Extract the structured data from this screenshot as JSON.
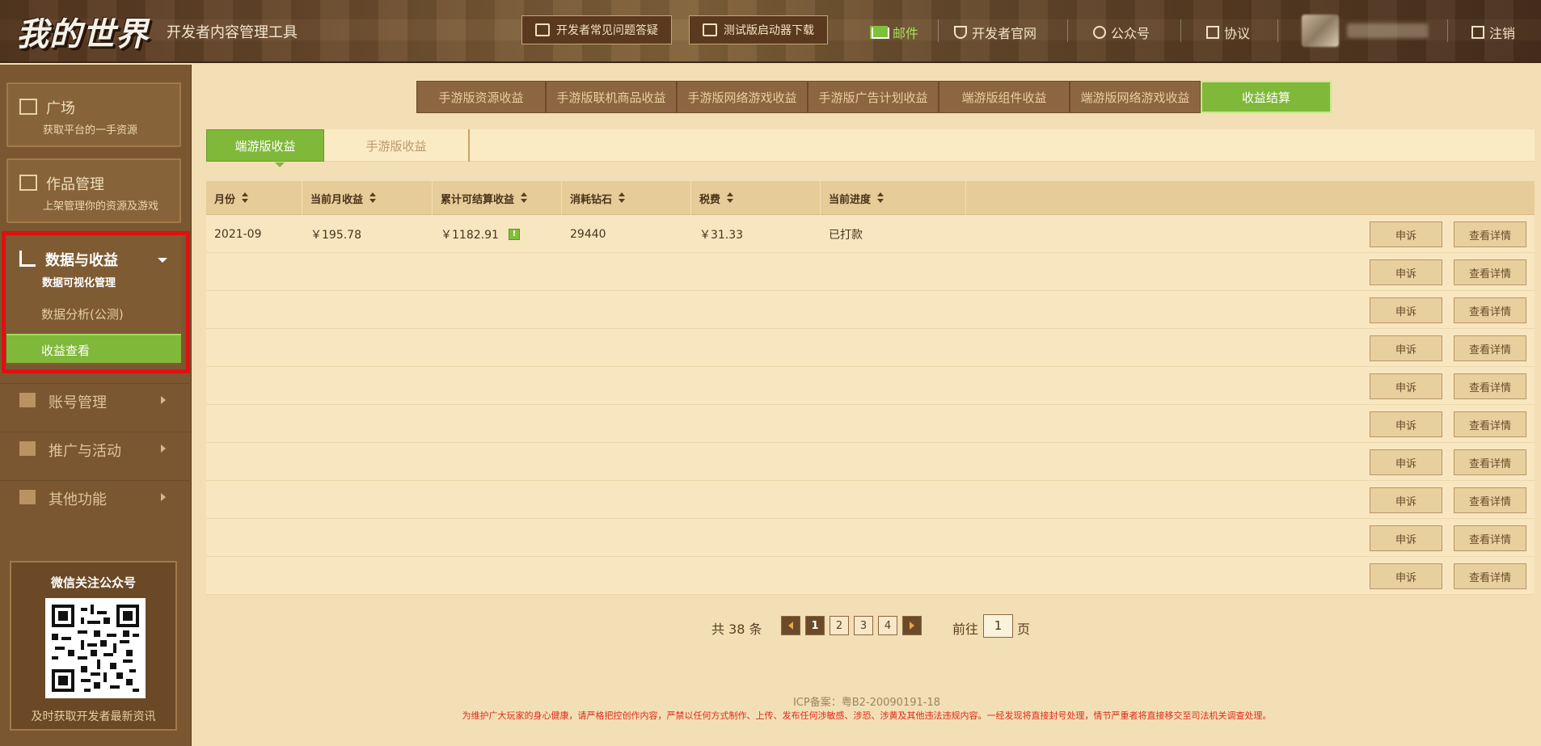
{
  "header": {
    "logo": "我的世界",
    "subtitle": "开发者内容管理工具",
    "faq_btn": "开发者常见问题答疑",
    "download_btn": "测试版启动器下载",
    "mail": "邮件",
    "official_site": "开发者官网",
    "wechat": "公众号",
    "agreement": "协议",
    "logout": "注销"
  },
  "sidebar": {
    "home": {
      "title": "广场",
      "sub": "获取平台的一手资源"
    },
    "works": {
      "title": "作品管理",
      "sub": "上架管理你的资源及游戏"
    },
    "data": {
      "title": "数据与收益",
      "sub": "数据可视化管理",
      "item1": "数据分析(公测)",
      "item2": "收益查看"
    },
    "nav": [
      "账号管理",
      "推广与活动",
      "其他功能"
    ],
    "wechat_card": {
      "title": "微信关注公众号",
      "bottom": "及时获取开发者最新资讯"
    }
  },
  "tabs": [
    "手游版资源收益",
    "手游版联机商品收益",
    "手游版网络游戏收益",
    "手游版广告计划收益",
    "端游版组件收益",
    "端游版网络游戏收益",
    "收益结算"
  ],
  "subtabs": [
    "端游版收益",
    "手游版收益"
  ],
  "table": {
    "headers": [
      "月份",
      "当前月收益",
      "累计可结算收益",
      "消耗钻石",
      "税费",
      "当前进度"
    ],
    "rows": [
      {
        "month": "2021-09",
        "income": "￥195.78",
        "total": "￥1182.91",
        "badge": "!",
        "diamonds": "29440",
        "tax": "￥31.33",
        "progress": "已打款"
      }
    ],
    "empty_rows": 9,
    "appeal": "申诉",
    "detail": "查看详情"
  },
  "pager": {
    "total": "共 38 条",
    "pages": [
      "1",
      "2",
      "3",
      "4"
    ],
    "current": "1",
    "goto": "前往",
    "goto_value": "1",
    "ye": "页"
  },
  "footer": {
    "icp": "ICP备案：粤B2-20090191-18",
    "warning": "为维护广大玩家的身心健康，请严格把控创作内容，严禁以任何方式制作、上传、发布任何涉敏感、涉恐、涉黄及其他违法违规内容。一经发现将直接封号处理，情节严重者将直接移交至司法机关调查处理。"
  },
  "colors": {
    "accent_green": "#80b83a",
    "brown": "#7a5731",
    "highlight_red": "#e01010",
    "warning_red": "#e02a1a"
  }
}
